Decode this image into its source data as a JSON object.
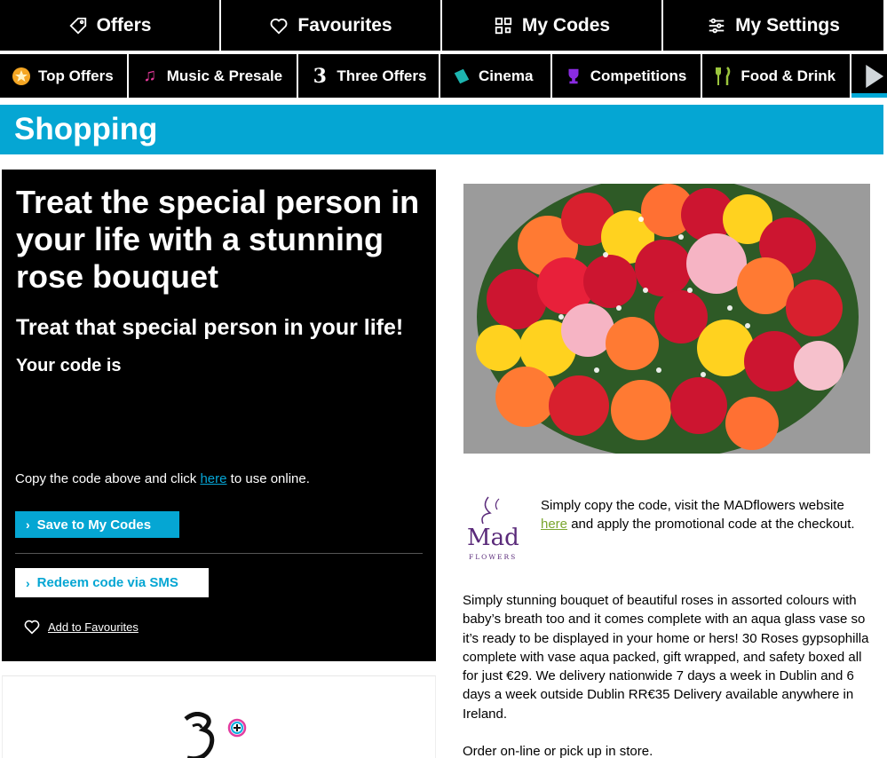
{
  "topnav": [
    {
      "label": "Offers",
      "icon": "tag-icon"
    },
    {
      "label": "Favourites",
      "icon": "heart-icon"
    },
    {
      "label": "My Codes",
      "icon": "qr-code-icon"
    },
    {
      "label": "My Settings",
      "icon": "sliders-icon"
    }
  ],
  "categories": [
    {
      "label": "Top Offers",
      "icon": "star-badge-icon",
      "color": "#f5a623"
    },
    {
      "label": "Music & Presale",
      "icon": "music-note-icon",
      "color": "#e6399b"
    },
    {
      "label": "Three Offers",
      "icon": "three-logo-icon",
      "color": "#ffffff"
    },
    {
      "label": "Cinema",
      "icon": "ticket-icon",
      "color": "#1db5b0"
    },
    {
      "label": "Competitions",
      "icon": "trophy-icon",
      "color": "#8a2be2"
    },
    {
      "label": "Food & Drink",
      "icon": "cutlery-icon",
      "color": "#9bc53d"
    }
  ],
  "section_title": "Shopping",
  "offer": {
    "headline": "Treat the special person in your life with a stunning rose bouquet",
    "subheadline": "Treat that special person in your life!",
    "code_label": "Your code is",
    "copy_text_before": "Copy the code above and click",
    "copy_link": "here",
    "copy_text_after": "to use online.",
    "save_button": "Save to My Codes",
    "redeem_button": "Redeem code via SMS",
    "favourites_link": "Add to Favourites"
  },
  "merchant": {
    "logo_text": "Mad",
    "logo_subtext": "FLOWERS",
    "instructions_before": "Simply copy the code, visit the MADflowers website",
    "instructions_link": "here",
    "instructions_after": "and apply the promotional code at the checkout."
  },
  "description": "Simply stunning bouquet of beautiful roses in assorted colours with baby’s breath too and it comes complete with an aqua glass vase so it’s ready to be displayed in your home or hers! 30 Roses gypsophilla complete with vase aqua packed, gift wrapped, and safety boxed all for just €29. We delivery nationwide 7 days a week in Dublin and 6 days a week outside Dublin RR€35 Delivery available anywhere in Ireland.",
  "order_text": "Order on-line or pick up in store.",
  "colors": {
    "accent": "#05a6d3",
    "link_green": "#7aa62e",
    "dark": "#000000"
  }
}
